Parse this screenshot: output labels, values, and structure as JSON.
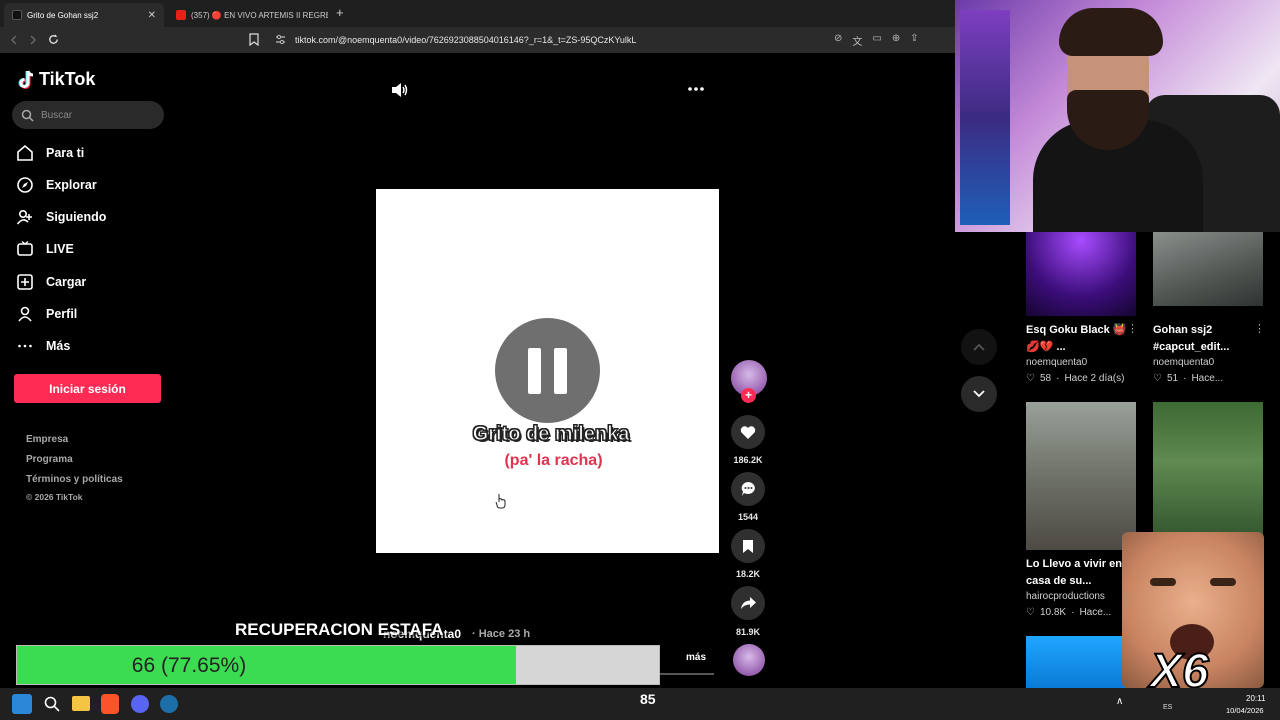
{
  "browser": {
    "tabs": [
      {
        "label": "Grito de Gohan ssj2",
        "active": true
      },
      {
        "label": "(357) 🔴 EN VIVO ARTEMIS II REGRE",
        "active": false
      }
    ],
    "new_tab": "+",
    "url": "tiktok.com/@noemquenta0/video/7626923088504016146?_r=1&_t=ZS-95QCzKYulkL"
  },
  "sidebar": {
    "logo": "TikTok",
    "search_placeholder": "Buscar",
    "nav": [
      {
        "label": "Para ti",
        "icon": "home-icon"
      },
      {
        "label": "Explorar",
        "icon": "compass-icon"
      },
      {
        "label": "Siguiendo",
        "icon": "following-icon"
      },
      {
        "label": "LIVE",
        "icon": "live-icon"
      },
      {
        "label": "Cargar",
        "icon": "upload-icon"
      },
      {
        "label": "Perfil",
        "icon": "profile-icon"
      },
      {
        "label": "Más",
        "icon": "more-icon"
      }
    ],
    "login": "Iniciar sesión",
    "footer": [
      "Empresa",
      "Programa",
      "Términos y políticas",
      "© 2026 TikTok"
    ]
  },
  "video": {
    "title": "Grito de milenka",
    "subtitle": "(pa' la racha)",
    "author_line": "noemquenta0",
    "time": "· Hace 23 h",
    "more": "más"
  },
  "actions": {
    "likes": "186.2K",
    "comments": "1544",
    "saves": "18.2K",
    "shares": "81.9K"
  },
  "overlay": {
    "label": "RECUPERACION ESTAFA",
    "progress_text": "66 (77.65%)",
    "progress_fraction": 0.7765,
    "counter": "85",
    "multiplier": "X6"
  },
  "related": [
    {
      "title": "Esq Goku Black 👹",
      "title2": "💋💔 ...",
      "author": "noemquenta0",
      "likes": "58",
      "when": "Hace 2 día(s)"
    },
    {
      "title": "Gohan ssj2",
      "title2": "#capcut_edit...",
      "author": "noemquenta0",
      "likes": "51",
      "when": "Hace..."
    },
    {
      "title": "Lo Llevo a vivir en",
      "title2": "casa de su...",
      "author": "hairocproductions",
      "likes": "10.8K",
      "when": "Hace..."
    }
  ],
  "taskbar": {
    "lang": "ES",
    "time": "20:11",
    "date": "10/04/2026"
  },
  "colors": {
    "accent": "#fe2c55",
    "progress": "#3cdc50",
    "subtitle_red": "#e0334f"
  }
}
